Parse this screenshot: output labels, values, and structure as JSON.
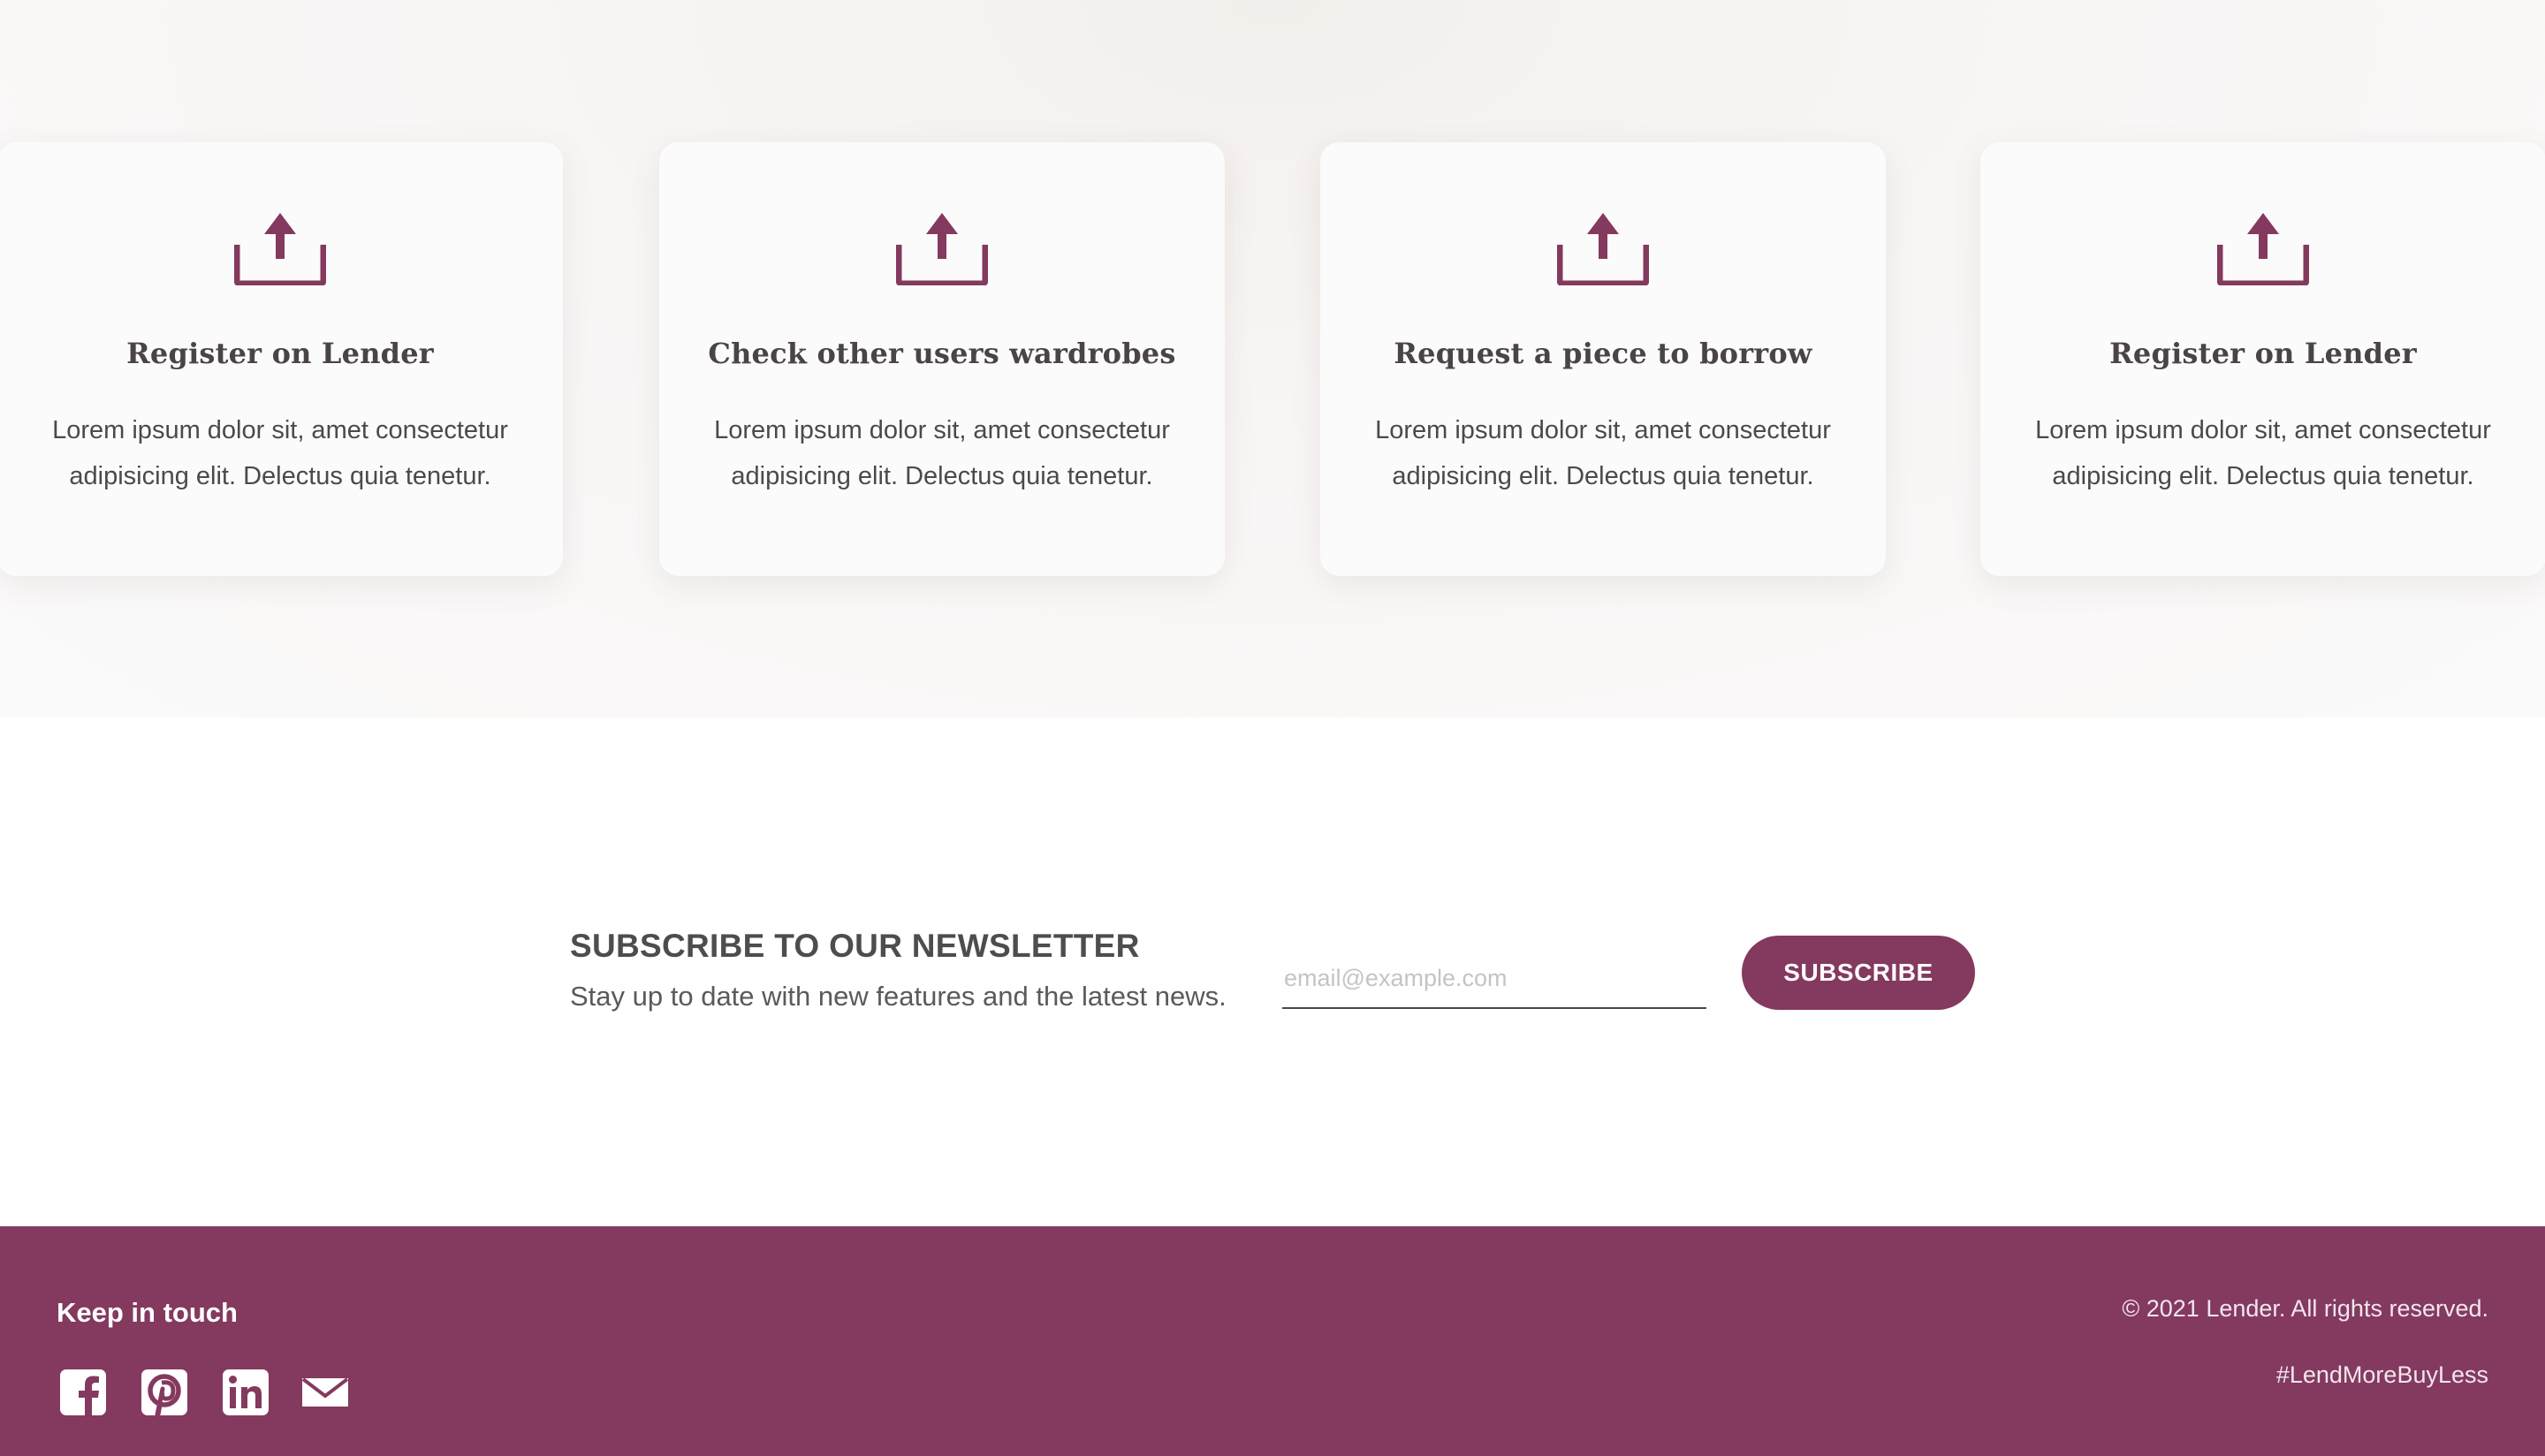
{
  "steps": [
    {
      "icon": "upload-icon",
      "title": "Register on Lender",
      "text": "Lorem ipsum dolor sit, amet consectetur adipisicing elit. Delectus quia tenetur."
    },
    {
      "icon": "upload-icon",
      "title": "Check other users wardrobes",
      "text": "Lorem ipsum dolor sit, amet consectetur adipisicing elit. Delectus quia tenetur."
    },
    {
      "icon": "upload-icon",
      "title": "Request a piece to borrow",
      "text": "Lorem ipsum dolor sit, amet consectetur adipisicing elit. Delectus quia tenetur."
    },
    {
      "icon": "upload-icon",
      "title": "Register on Lender",
      "text": "Lorem ipsum dolor sit, amet consectetur adipisicing elit. Delectus quia tenetur."
    }
  ],
  "newsletter": {
    "title": "SUBSCRIBE TO OUR NEWSLETTER",
    "subtitle": "Stay up to date with new features and the latest news.",
    "email_placeholder": "email@example.com",
    "email_value": "",
    "button_label": "SUBSCRIBE"
  },
  "footer": {
    "keep_in_touch": "Keep in touch",
    "social_icons": [
      "facebook-icon",
      "pinterest-icon",
      "linkedin-icon",
      "mail-icon"
    ],
    "copyright": "© 2021 Lender. All rights reserved.",
    "hashtag": "#LendMoreBuyLess"
  },
  "colors": {
    "brand": "#84395f",
    "card_background": "#fcfbfb",
    "text": "#4a4446"
  }
}
